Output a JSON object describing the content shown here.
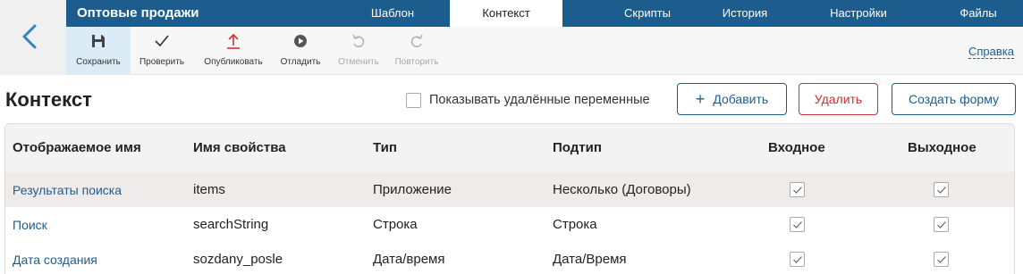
{
  "nav": {
    "back_icon": "chevron-left-icon"
  },
  "topbar": {
    "app_title": "Оптовые продажи",
    "tabs": [
      {
        "label": "Шаблон",
        "active": false
      },
      {
        "label": "Контекст",
        "active": true
      },
      {
        "label": "Скрипты",
        "active": false
      },
      {
        "label": "История",
        "active": false
      },
      {
        "label": "Настройки",
        "active": false
      },
      {
        "label": "Файлы",
        "active": false
      }
    ]
  },
  "toolbar": {
    "tools": [
      {
        "label": "Сохранить",
        "icon": "save-icon",
        "active": true,
        "disabled": false
      },
      {
        "label": "Проверить",
        "icon": "check-icon",
        "active": false,
        "disabled": false
      },
      {
        "label": "Опубликовать",
        "icon": "publish-icon",
        "active": false,
        "disabled": false
      },
      {
        "label": "Отладить",
        "icon": "play-icon",
        "active": false,
        "disabled": false
      },
      {
        "label": "Отменить",
        "icon": "undo-icon",
        "active": false,
        "disabled": true
      },
      {
        "label": "Повторить",
        "icon": "redo-icon",
        "active": false,
        "disabled": true
      }
    ],
    "help_label": "Справка"
  },
  "main": {
    "title": "Контекст",
    "show_deleted_label": "Показывать удалённые переменные",
    "show_deleted_checked": false,
    "add_label": "Добавить",
    "delete_label": "Удалить",
    "create_form_label": "Создать форму"
  },
  "table": {
    "columns": [
      "Отображаемое имя",
      "Имя свойства",
      "Тип",
      "Подтип",
      "Входное",
      "Выходное"
    ],
    "rows": [
      {
        "display_name": "Результаты поиска",
        "property": "items",
        "type": "Приложение",
        "subtype": "Несколько (Договоры)",
        "input": true,
        "output": true
      },
      {
        "display_name": "Поиск",
        "property": "searchString",
        "type": "Строка",
        "subtype": "Строка",
        "input": true,
        "output": true
      },
      {
        "display_name": "Дата создания",
        "property": "sozdany_posle",
        "type": "Дата/время",
        "subtype": "Дата/Время",
        "input": true,
        "output": true
      }
    ]
  },
  "colors": {
    "brand": "#1c5d8d",
    "danger": "#c8303a",
    "highlight_row": "#f0ebeb"
  }
}
